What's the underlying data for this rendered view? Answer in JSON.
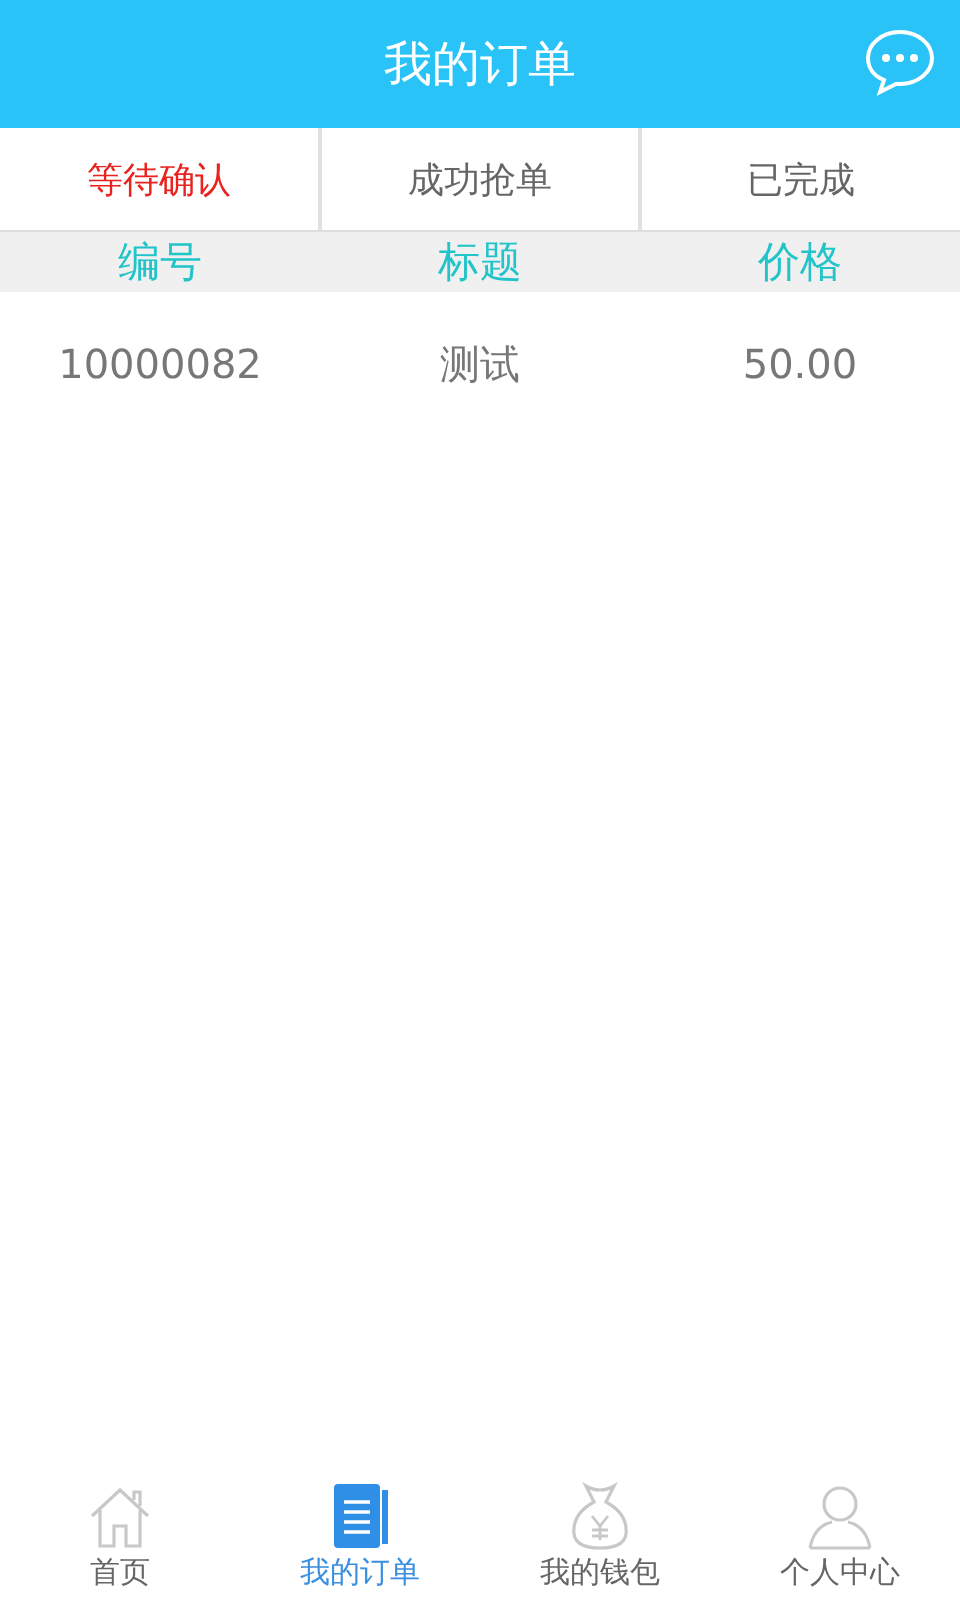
{
  "header": {
    "title": "我的订单"
  },
  "tabs": [
    {
      "label": "等待确认",
      "selected": true
    },
    {
      "label": "成功抢单",
      "selected": false
    },
    {
      "label": "已完成",
      "selected": false
    }
  ],
  "table": {
    "columns": [
      "编号",
      "标题",
      "价格"
    ],
    "rows": [
      [
        "10000082",
        "测试",
        "50.00"
      ]
    ]
  },
  "bottom_nav": [
    {
      "kind": "home",
      "label": "首页",
      "selected": false
    },
    {
      "kind": "orders",
      "label": "我的订单",
      "selected": true
    },
    {
      "kind": "wallet",
      "label": "我的钱包",
      "selected": false
    },
    {
      "kind": "profile",
      "label": "个人中心",
      "selected": false
    }
  ]
}
